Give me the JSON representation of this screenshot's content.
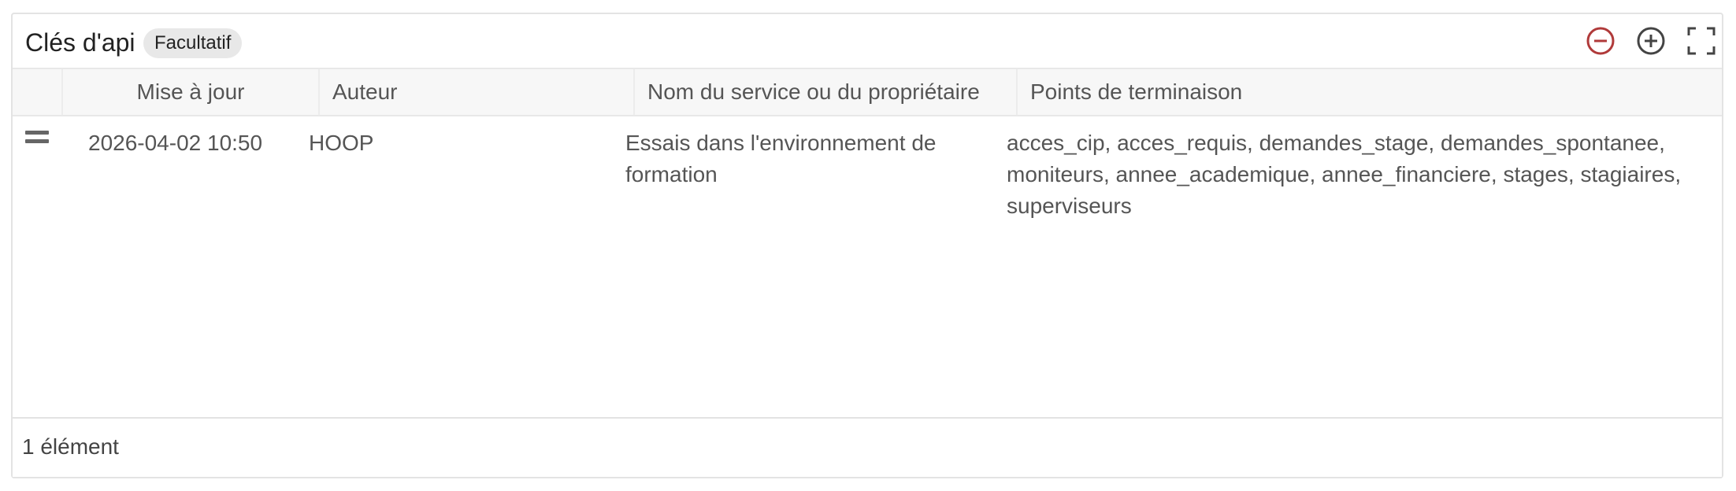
{
  "panel": {
    "title": "Clés d'api",
    "badge": "Facultatif",
    "tools": [
      {
        "name": "collapse-icon",
        "color": "#b03a3a"
      },
      {
        "name": "expand-icon",
        "color": "#444444"
      },
      {
        "name": "fullscreen-icon",
        "color": "#444444"
      }
    ]
  },
  "table": {
    "columns": [
      "",
      "Mise à jour",
      "Auteur",
      "Nom du service ou du propriétaire",
      "Points de terminaison"
    ],
    "rows": [
      {
        "updated": "2026-04-02 10:50",
        "author": "HOOP",
        "service_line1": "Essais dans l'environnement de",
        "service_line2": "formation",
        "endpoints_line1": "acces_cip, acces_requis, demandes_stage, demandes_spontanee,",
        "endpoints_line2": "moniteurs, annee_academique, annee_financiere, stages, stagiaires,",
        "endpoints_line3": "superviseurs"
      }
    ]
  },
  "footer": {
    "count": "1 élément"
  }
}
